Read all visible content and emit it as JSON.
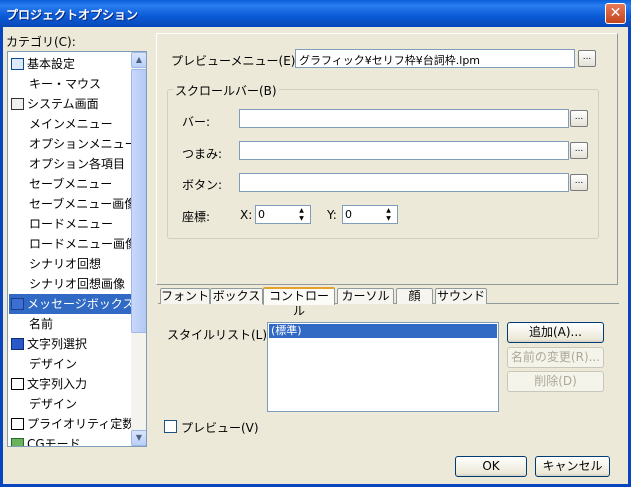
{
  "window": {
    "title": "プロジェクトオプション",
    "close_glyph": "✕"
  },
  "category": {
    "label": "カテゴリ(C):",
    "items": [
      {
        "label": "基本設定",
        "indent": false,
        "icon": "basic-settings-icon",
        "selected": false
      },
      {
        "label": "キー・マウス",
        "indent": true,
        "icon": "",
        "selected": false
      },
      {
        "label": "システム画面",
        "indent": false,
        "icon": "system-screen-icon",
        "selected": false
      },
      {
        "label": "メインメニュー",
        "indent": true,
        "icon": "",
        "selected": false
      },
      {
        "label": "オプションメニュー",
        "indent": true,
        "icon": "",
        "selected": false
      },
      {
        "label": "オプション各項目",
        "indent": true,
        "icon": "",
        "selected": false
      },
      {
        "label": "セーブメニュー",
        "indent": true,
        "icon": "",
        "selected": false
      },
      {
        "label": "セーブメニュー画像",
        "indent": true,
        "icon": "",
        "selected": false
      },
      {
        "label": "ロードメニュー",
        "indent": true,
        "icon": "",
        "selected": false
      },
      {
        "label": "ロードメニュー画像",
        "indent": true,
        "icon": "",
        "selected": false
      },
      {
        "label": "シナリオ回想",
        "indent": true,
        "icon": "",
        "selected": false
      },
      {
        "label": "シナリオ回想画像",
        "indent": true,
        "icon": "",
        "selected": false
      },
      {
        "label": "メッセージボックス",
        "indent": false,
        "icon": "message-box-icon",
        "selected": true
      },
      {
        "label": "名前",
        "indent": true,
        "icon": "",
        "selected": false
      },
      {
        "label": "文字列選択",
        "indent": false,
        "icon": "string-select-icon",
        "selected": false
      },
      {
        "label": "デザイン",
        "indent": true,
        "icon": "",
        "selected": false
      },
      {
        "label": "文字列入力",
        "indent": false,
        "icon": "string-input-icon",
        "selected": false
      },
      {
        "label": "デザイン",
        "indent": true,
        "icon": "",
        "selected": false
      },
      {
        "label": "プライオリティ定数",
        "indent": false,
        "icon": "priority-icon",
        "selected": false
      },
      {
        "label": "CGモード",
        "indent": false,
        "icon": "cg-mode-icon",
        "selected": false
      }
    ]
  },
  "preview_menu": {
    "label": "プレビューメニュー(E):",
    "value": "グラフィック¥セリフ枠¥台詞枠.lpm",
    "browse": "..."
  },
  "scrollbar_group": {
    "label": "スクロールバー(B)",
    "bar_label": "バー:",
    "bar_value": "",
    "knob_label": "つまみ:",
    "knob_value": "",
    "button_label": "ボタン:",
    "button_value": "",
    "browse": "...",
    "coord_label": "座標:",
    "x_label": "X:",
    "x_value": "0",
    "y_label": "Y:",
    "y_value": "0"
  },
  "tabs": [
    "フォント",
    "ボックス",
    "コントロール",
    "カーソル",
    "顔",
    "サウンド"
  ],
  "active_tab": 2,
  "style_list": {
    "label": "スタイルリスト(L):",
    "items": [
      "(標準)"
    ]
  },
  "buttons": {
    "add": "追加(A)...",
    "rename": "名前の変更(R)...",
    "delete": "削除(D)",
    "ok": "OK",
    "cancel": "キャンセル"
  },
  "preview_check": {
    "label": "プレビュー(V)",
    "checked": false
  }
}
